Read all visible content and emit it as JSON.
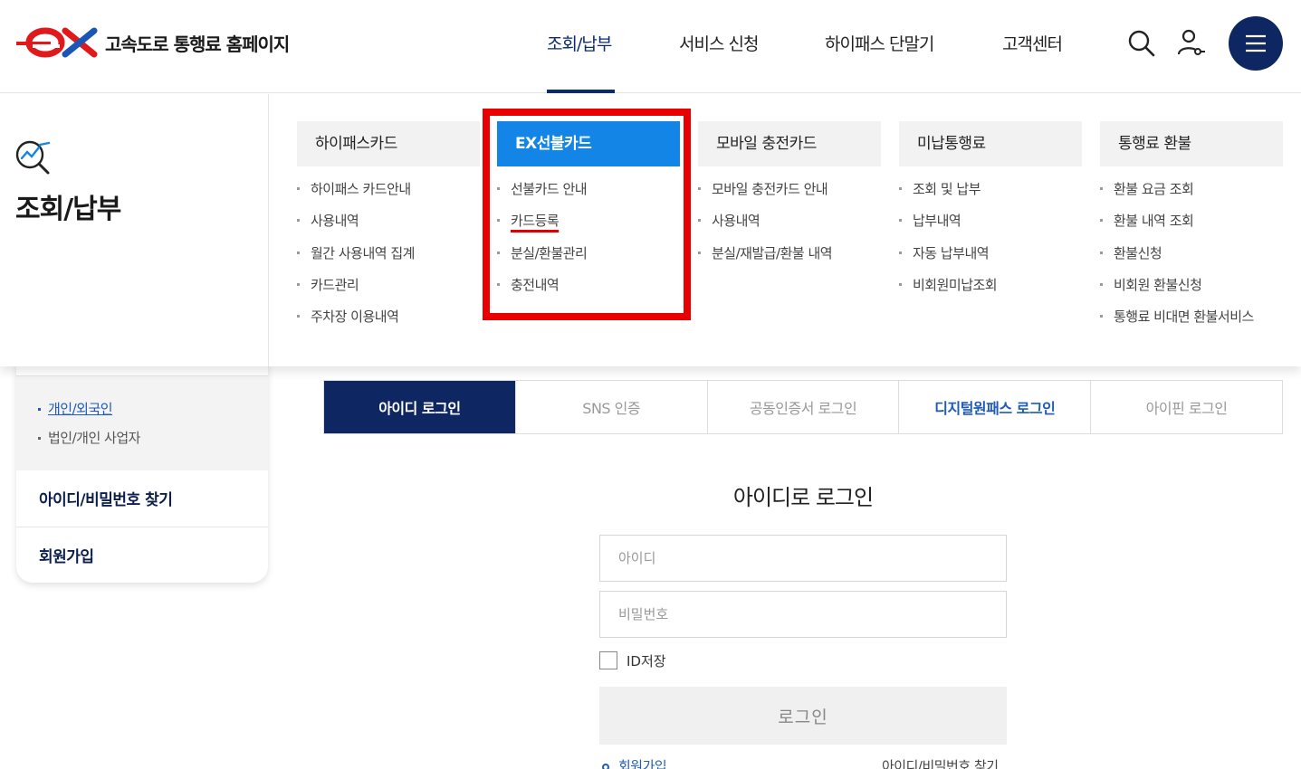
{
  "header": {
    "site_title": "고속도로 통행료 홈페이지",
    "nav": [
      "조회/납부",
      "서비스 신청",
      "하이패스 단말기",
      "고객센터"
    ],
    "active_nav": "조회/납부",
    "icons": [
      "search-icon",
      "user-icon",
      "menu-icon"
    ],
    "accent_color": "#0e2763"
  },
  "mega_menu": {
    "section_title": "조회/납부",
    "columns": [
      {
        "title": "하이패스카드",
        "items": [
          "하이패스 카드안내",
          "사용내역",
          "월간 사용내역 집계",
          "카드관리",
          "주차장 이용내역"
        ]
      },
      {
        "title": "EX선불카드",
        "items": [
          "선불카드 안내",
          "카드등록",
          "분실/환불관리",
          "충전내역"
        ]
      },
      {
        "title": "모바일 충전카드",
        "items": [
          "모바일 충전카드 안내",
          "사용내역",
          "분실/재발급/환불 내역"
        ]
      },
      {
        "title": "미납통행료",
        "items": [
          "조회 및 납부",
          "납부내역",
          "자동 납부내역",
          "비회원미납조회"
        ]
      },
      {
        "title": "통행료 환불",
        "items": [
          "환불 요금 조회",
          "환불 내역 조회",
          "환불신청",
          "비회원 환불신청",
          "통행료 비대면 환불서비스"
        ]
      }
    ],
    "highlight_color": "#1385e6"
  },
  "sidebar": {
    "sub_items": [
      "개인/외국인",
      "법인/개인 사업자"
    ],
    "links": [
      "아이디/비밀번호 찾기",
      "회원가입"
    ]
  },
  "login": {
    "tabs": [
      "아이디 로그인",
      "SNS 인증",
      "공동인증서 로그인",
      "디지털원패스 로그인",
      "아이핀 로그인"
    ],
    "title": "아이디로 로그인",
    "id_placeholder": "아이디",
    "pw_placeholder": "비밀번호",
    "save_id_label": "ID저장",
    "login_button": "로그인",
    "join_link": "회원가입",
    "find_link": "아이디/비밀번호 찾기"
  }
}
